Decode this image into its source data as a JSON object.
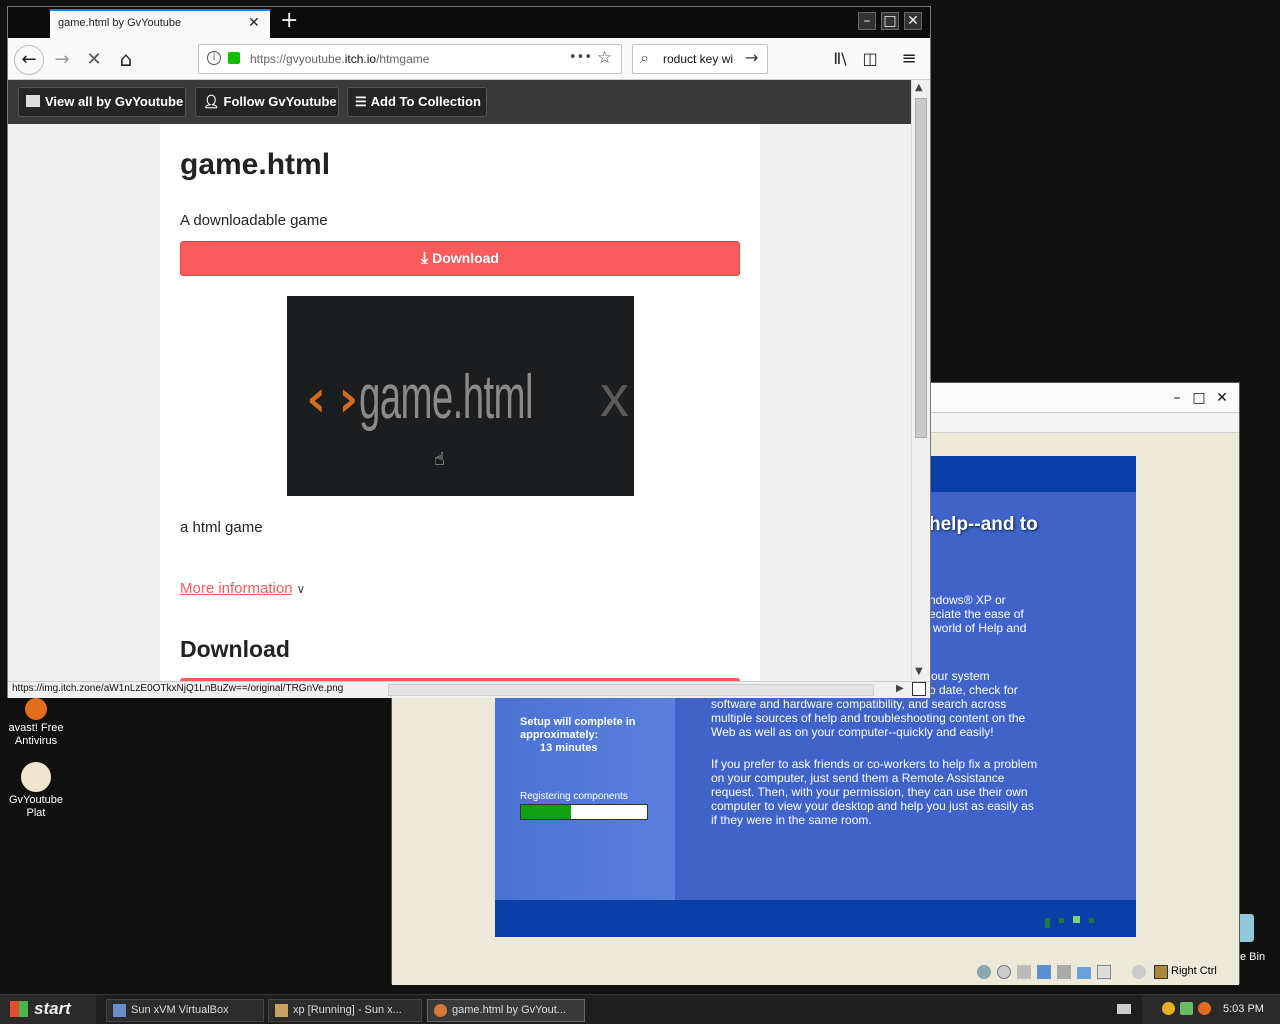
{
  "desktop": {
    "icons": [
      {
        "label_line1": "avast! Free",
        "label_line2": "Antivirus"
      },
      {
        "label_line1": "GvYoutube",
        "label_line2": "Plat"
      }
    ],
    "recycle_partial": "e Bin"
  },
  "vm_window": {
    "xp_heading": "help--and to",
    "xp_para1": [
      "ndows® XP or",
      "eciate the ease of",
      "world of Help and"
    ],
    "xp_para2": [
      "our system",
      "o date, check for",
      "software and hardware compatibility, and search across",
      "multiple sources of help and troubleshooting content on the",
      "Web as well as on your computer--quickly and easily!"
    ],
    "xp_para3": [
      "If you prefer to ask friends or co-workers to help fix a problem",
      "on your computer, just send them a Remote Assistance",
      "request. Then, with your permission, they can use their own",
      "computer to view your desktop and help you just as easily as",
      "if they were in the same room."
    ],
    "setup_line1": "Setup will complete in",
    "setup_line2": "approximately:",
    "setup_line3": "13 minutes",
    "registering": "Registering components",
    "progress_fraction": 0.4,
    "status_right_ctrl": "Right Ctrl"
  },
  "browser": {
    "tab_title": "game.html by GvYoutube",
    "new_tab": "+",
    "url_prefix": "https://gvyoutube.",
    "url_domain": "itch.io",
    "url_path": "/htmgame",
    "url_more": "•••",
    "search_text": "roduct key wi",
    "itch_bar": {
      "view_all": "View all by GvYoutube",
      "follow": "Follow GvYoutube",
      "add_collection": "Add To Collection"
    },
    "page": {
      "title": "game.html",
      "subtitle": "A downloadable game",
      "download_btn": "Download",
      "banner_text": "game.html",
      "banner_x": "x",
      "description": "a html game",
      "more_info": "More information",
      "download_heading": "Download"
    },
    "status_url": "https://img.itch.zone/aW1nLzE0OTkxNjQ1LnBuZw==/original/TRGnVe.png"
  },
  "taskbar": {
    "start": "start",
    "items": [
      "Sun xVM VirtualBox",
      "xp [Running] - Sun x...",
      "game.html by GvYout..."
    ],
    "time": "5:03 PM"
  },
  "colors": {
    "itch_red": "#fa5c5c",
    "xp_blue": "#0a3fa8",
    "progress_green": "#11a011"
  }
}
